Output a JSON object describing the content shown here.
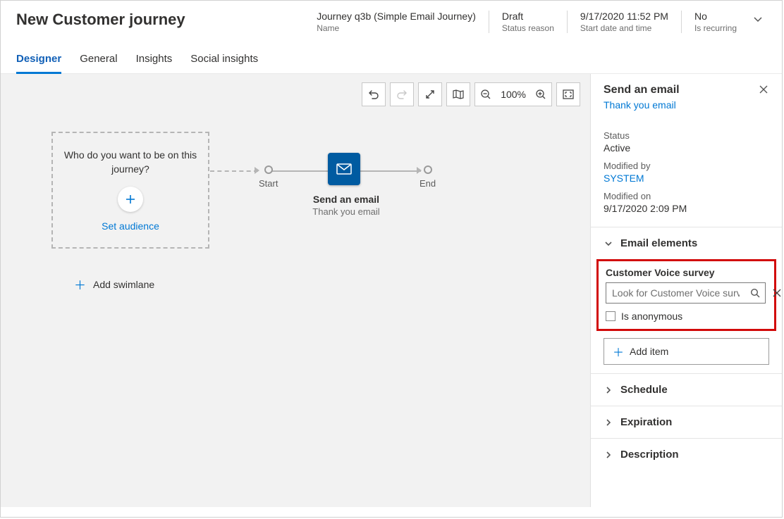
{
  "header": {
    "title": "New Customer journey",
    "fields": [
      {
        "value": "Journey q3b (Simple Email Journey)",
        "label": "Name"
      },
      {
        "value": "Draft",
        "label": "Status reason"
      },
      {
        "value": "9/17/2020 11:52 PM",
        "label": "Start date and time"
      },
      {
        "value": "No",
        "label": "Is recurring"
      }
    ]
  },
  "tabs": [
    "Designer",
    "General",
    "Insights",
    "Social insights"
  ],
  "canvas": {
    "audience_question": "Who do you want to be on this journey?",
    "set_audience": "Set audience",
    "start": "Start",
    "end": "End",
    "email_title": "Send an email",
    "email_sub": "Thank you email",
    "add_swimlane": "Add swimlane",
    "zoom": "100%"
  },
  "panel": {
    "title": "Send an email",
    "subtitle": "Thank you email",
    "status_label": "Status",
    "status_value": "Active",
    "modby_label": "Modified by",
    "modby_value": "SYSTEM",
    "modon_label": "Modified on",
    "modon_value": "9/17/2020 2:09 PM",
    "section_email_elements": "Email elements",
    "cv_label": "Customer Voice survey",
    "cv_placeholder": "Look for Customer Voice survey",
    "is_anonymous": "Is anonymous",
    "add_item": "Add item",
    "section_schedule": "Schedule",
    "section_expiration": "Expiration",
    "section_description": "Description"
  }
}
